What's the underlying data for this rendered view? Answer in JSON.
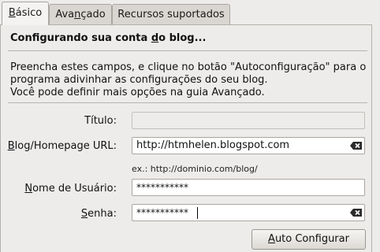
{
  "tabs": [
    {
      "label": "Básico",
      "mnemonic": "B",
      "rest": "ásico",
      "active": true
    },
    {
      "label": "Avançado",
      "mnemonic_before": "Ava",
      "mnemonic": "n",
      "rest": "çado",
      "active": false
    },
    {
      "label": "Recursos suportados",
      "active": false
    }
  ],
  "section": {
    "heading_before": "Configurando sua conta ",
    "heading_mnemonic": "d",
    "heading_after": "o blog...",
    "desc_lines": [
      "Preencha estes campos, e clique no botão \"Autoconfiguração\" para o",
      "programa adivinhar as configurações do seu blog.",
      "Você pode definir mais opções na guia Avançado."
    ]
  },
  "form": {
    "title": {
      "label": "Título:",
      "value": ""
    },
    "url": {
      "label_mnemonic": "B",
      "label_rest": "log/Homepage URL:",
      "value": "http://htmhelen.blogspot.com",
      "hint": "ex.: http://dominio.com/blog/"
    },
    "username": {
      "label_mnemonic": "N",
      "label_rest": "ome de Usuário:",
      "value": "***********"
    },
    "password": {
      "label_mnemonic": "S",
      "label_rest": "enha:",
      "value": "***********"
    }
  },
  "buttons": {
    "auto_config_mnemonic": "A",
    "auto_config_rest": "uto Configurar"
  },
  "icons": {
    "clear": "clear-text-icon"
  }
}
